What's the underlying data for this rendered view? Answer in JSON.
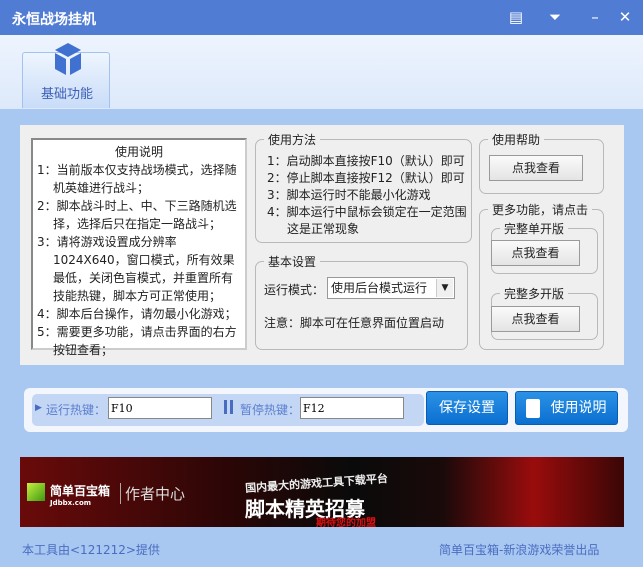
{
  "window": {
    "title": "永恒战场挂机"
  },
  "tabs": [
    {
      "label": "基础功能"
    }
  ],
  "instructions": {
    "title": "使用说明",
    "items": [
      "1：当前版本仅支持战场模式，选择随机英雄进行战斗；",
      "2：脚本战斗时上、中、下三路随机选择，选择后只在指定一路战斗；",
      "3：请将游戏设置成分辨率1024X640，窗口模式，所有效果最低，关闭色盲模式，并重置所有技能热键，脚本方可正常使用；",
      "4：脚本后台操作，请勿最小化游戏；",
      "5：需要更多功能，请点击界面的右方按钮查看；"
    ]
  },
  "usage": {
    "title": "使用方法",
    "lines": [
      "1：启动脚本直接按F10（默认）即可",
      "2：停止脚本直接按F12（默认）即可",
      "3：脚本运行时不能最小化游戏",
      "4：脚本运行中鼠标会锁定在一定范围",
      "这是正常现象"
    ]
  },
  "basic": {
    "title": "基本设置",
    "mode_label": "运行模式：",
    "mode_value": "使用后台模式运行",
    "note": "注意：脚本可在任意界面位置启动"
  },
  "help": {
    "title": "使用帮助",
    "button": "点我查看"
  },
  "more": {
    "title": "更多功能，请点击",
    "single": {
      "title": "完整单开版",
      "button": "点我查看"
    },
    "multi": {
      "title": "完整多开版",
      "button": "点我查看"
    }
  },
  "hotkeys": {
    "run_label": "运行热键：",
    "run_value": "F10",
    "pause_label": "暂停热键：",
    "pause_value": "F12",
    "save_button": "保存设置",
    "manual_button": "使用说明"
  },
  "banner": {
    "brand": "简单百宝箱",
    "domain": "Jdbbx.com",
    "center": "作者中心",
    "line1": "国内最大的游戏工具下载平台",
    "line2": "脚本精英招募",
    "line3": "期待您的加盟"
  },
  "footer": {
    "left": "本工具由<121212>提供",
    "right": "简单百宝箱-新浪游戏荣誉出品"
  }
}
